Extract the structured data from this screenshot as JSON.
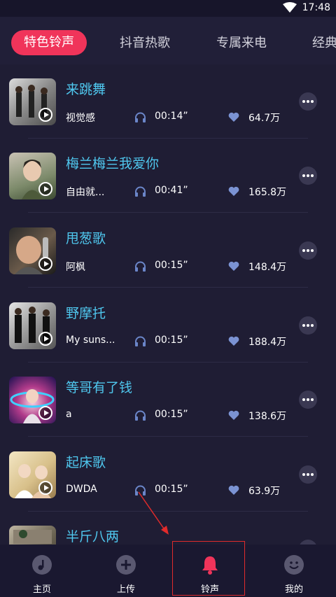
{
  "status": {
    "time": "17:48"
  },
  "tabs": [
    {
      "label": "特色铃声",
      "active": true
    },
    {
      "label": "抖音热歌",
      "active": false
    },
    {
      "label": "专属来电",
      "active": false
    },
    {
      "label": "经典",
      "active": false
    }
  ],
  "songs": [
    {
      "title": "来跳舞",
      "artist": "视觉感",
      "duration": "00:14”",
      "likes": "64.7万"
    },
    {
      "title": "梅兰梅兰我爱你",
      "artist": "自由就...",
      "duration": "00:41”",
      "likes": "165.8万"
    },
    {
      "title": "甩葱歌",
      "artist": "阿枫",
      "duration": "00:15”",
      "likes": "148.4万"
    },
    {
      "title": "野摩托",
      "artist": "My suns...",
      "duration": "00:15”",
      "likes": "188.4万"
    },
    {
      "title": "等哥有了钱",
      "artist": "a",
      "duration": "00:15”",
      "likes": "138.6万"
    },
    {
      "title": "起床歌",
      "artist": "DWDA",
      "duration": "00:15”",
      "likes": "63.9万"
    },
    {
      "title": "半斤八两",
      "artist": "",
      "duration": "",
      "likes": ""
    }
  ],
  "nav": [
    {
      "label": "主页",
      "icon": "music-note-icon"
    },
    {
      "label": "上传",
      "icon": "plus-icon"
    },
    {
      "label": "铃声",
      "icon": "bell-icon",
      "active": true
    },
    {
      "label": "我的",
      "icon": "smiley-icon"
    }
  ],
  "colors": {
    "background": "#1f1d34",
    "accent": "#f0345a",
    "title": "#4fc7ee",
    "annotation": "#e12b2b"
  }
}
